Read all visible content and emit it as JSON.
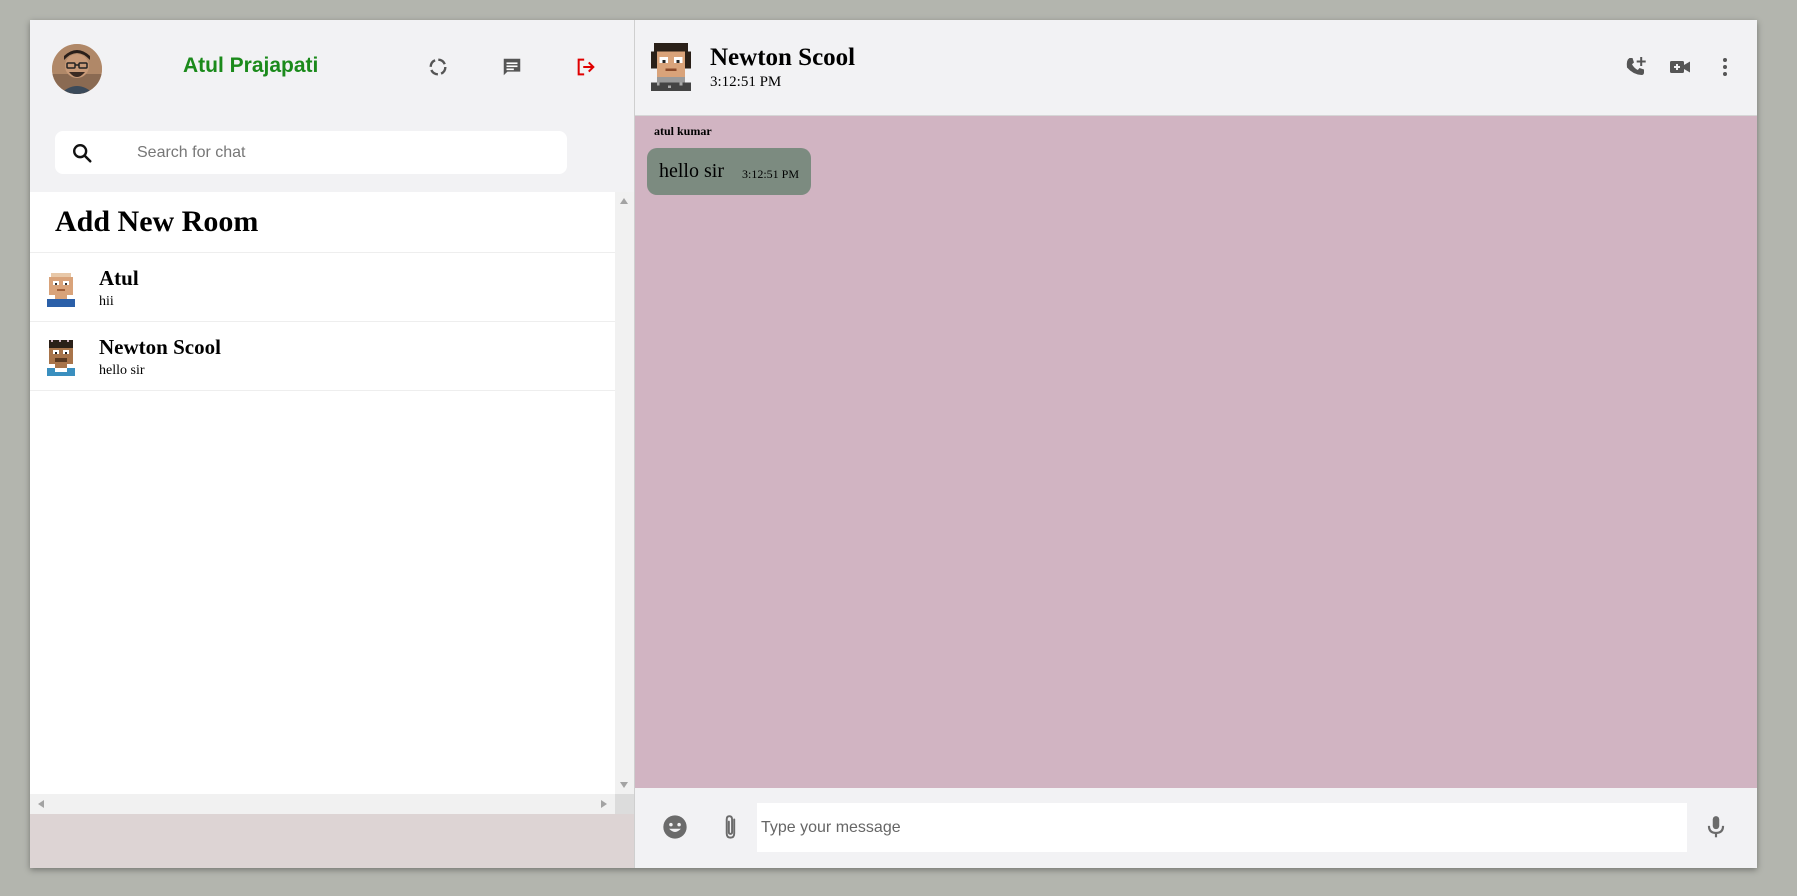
{
  "sidebar": {
    "user_name": "Atul Prajapati",
    "search_placeholder": "Search for chat",
    "add_room_label": "Add New Room",
    "chats": [
      {
        "name": "Atul",
        "last_message": "hii"
      },
      {
        "name": "Newton Scool",
        "last_message": "hello sir"
      }
    ]
  },
  "chat": {
    "title": "Newton Scool",
    "time": "3:12:51 PM",
    "messages": [
      {
        "sender": "atul kumar",
        "text": "hello sir",
        "timestamp": "3:12:51 PM"
      }
    ],
    "composer_placeholder": "Type your message"
  },
  "colors": {
    "user_name": "#1b8a1b",
    "logout_icon": "#e00000",
    "chat_background": "#d1b4c2",
    "bubble": "#7c8b80",
    "icon_gray": "#555555"
  },
  "icons": {
    "status": "circle-notch-icon",
    "new_chat": "chat-bubble-icon",
    "logout": "logout-icon",
    "search": "search-icon",
    "add_call": "add-call-icon",
    "video": "video-camera-icon",
    "more": "more-vert-icon",
    "emoji": "emoji-icon",
    "attach": "paperclip-icon",
    "mic": "microphone-icon"
  }
}
